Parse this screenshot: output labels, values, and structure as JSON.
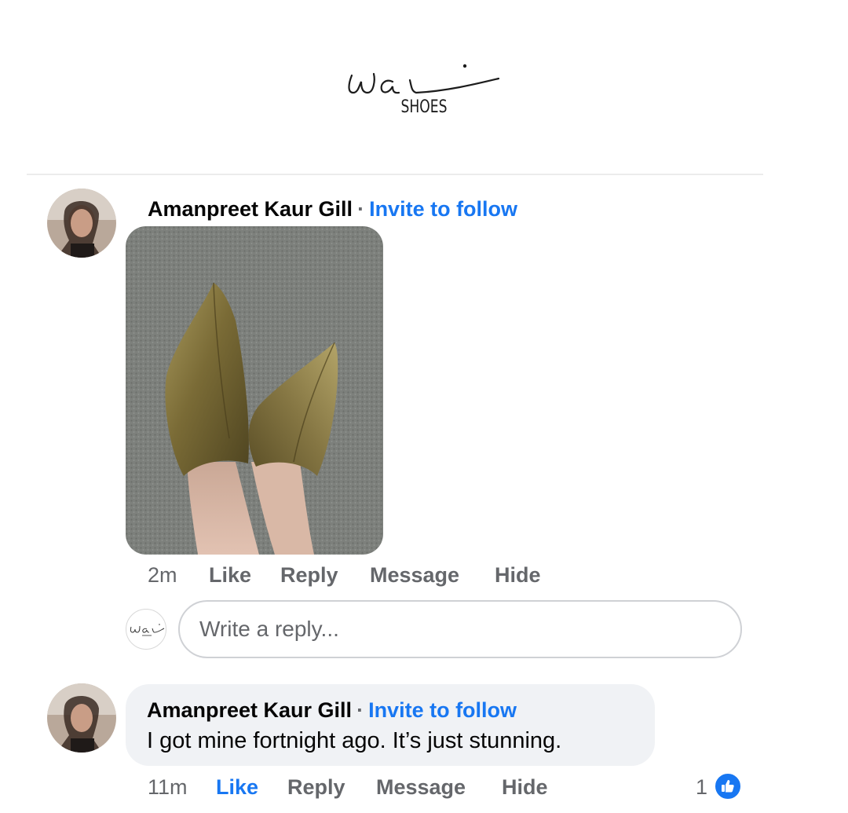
{
  "brand": {
    "logo_script": "wai",
    "logo_sub": "SHOES"
  },
  "comments": [
    {
      "author": "Amanpreet Kaur Gill",
      "separator": "·",
      "invite": "Invite to follow",
      "has_photo": true,
      "actions": {
        "time": "2m",
        "like": "Like",
        "reply": "Reply",
        "message": "Message",
        "hide": "Hide"
      }
    },
    {
      "author": "Amanpreet Kaur Gill",
      "separator": "·",
      "invite": "Invite to follow",
      "text": "I got mine fortnight ago. It’s just stunning.",
      "actions": {
        "time": "11m",
        "like": "Like",
        "reply": "Reply",
        "message": "Message",
        "hide": "Hide"
      },
      "liked": true,
      "reaction_count": "1"
    }
  ],
  "reply_input": {
    "placeholder": "Write a reply..."
  },
  "colors": {
    "link_blue": "#1877f2",
    "meta_gray": "#65676b",
    "bubble_bg": "#f0f2f5"
  }
}
